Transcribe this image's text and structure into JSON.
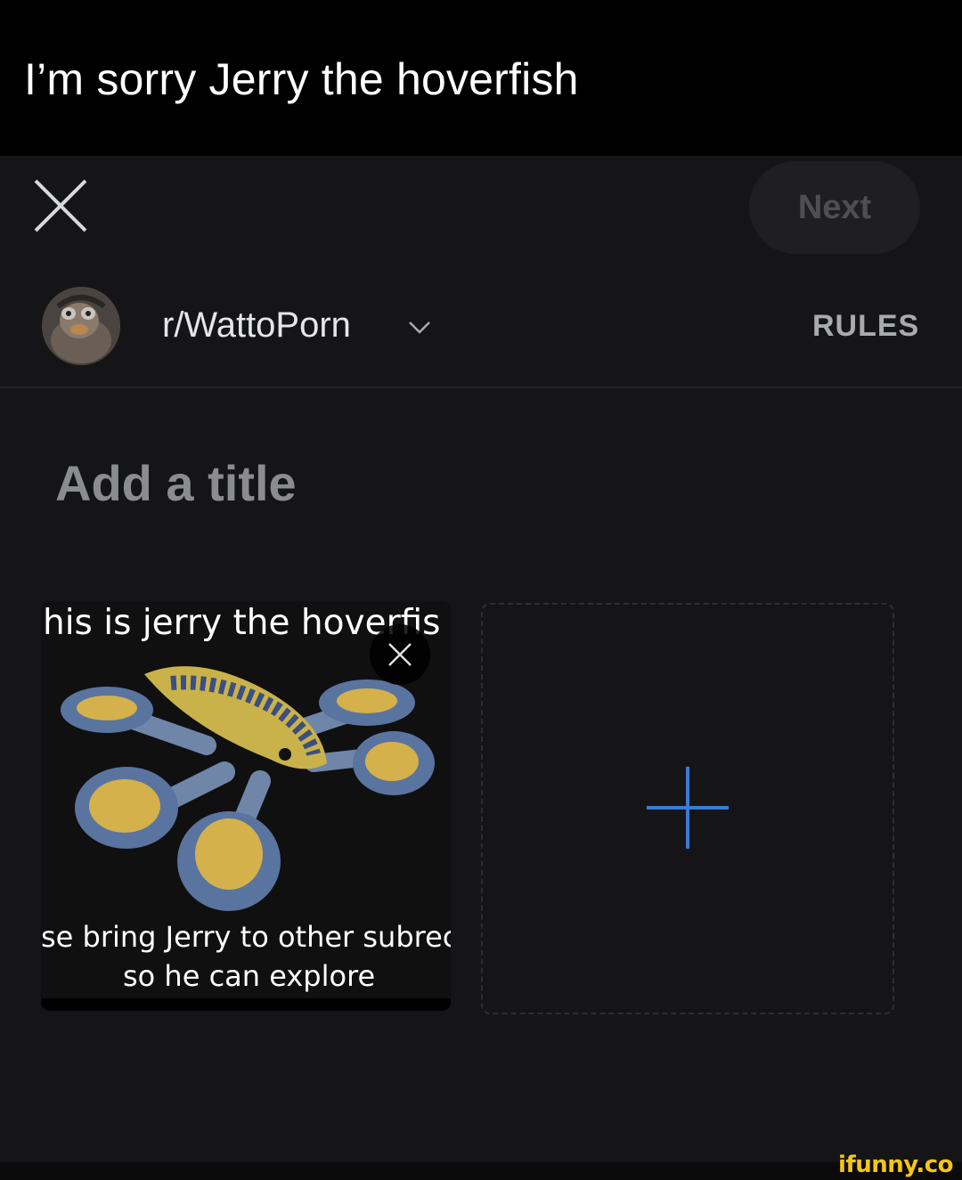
{
  "caption": "I’m sorry Jerry the hoverfish",
  "header": {
    "next_label": "Next"
  },
  "community": {
    "name": "r/WattoPorn",
    "rules_label": "RULES"
  },
  "post": {
    "title_placeholder": "Add a title"
  },
  "media": {
    "top_text": "his is jerry the hoverfis",
    "bottom_line1": "se bring Jerry to other subrec",
    "bottom_line2": "so he can explore"
  },
  "watermark": "ifunny.co",
  "colors": {
    "accent_blue": "#3a7bd5",
    "background": "#151517",
    "caption_bg": "#000000"
  }
}
